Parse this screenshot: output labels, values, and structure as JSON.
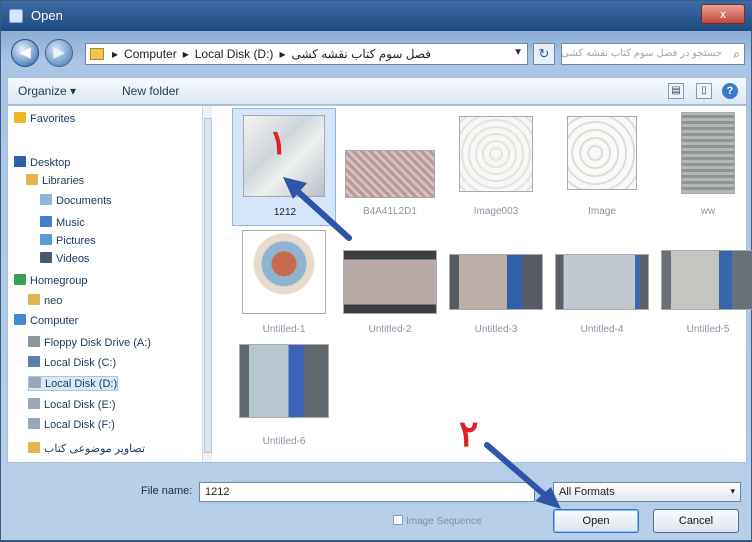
{
  "window": {
    "title": "Open",
    "close_label": "x"
  },
  "navigation": {
    "back_glyph": "◀",
    "forward_glyph": "▶",
    "breadcrumbs": [
      "Computer",
      "Local Disk (D:)",
      "فصل سوم کتاب نقشه کشی"
    ],
    "breadcrumb_separator": "▸",
    "refresh_glyph": "↻",
    "search_placeholder": "جستجو در فصل سوم کتاب نقشه کشی"
  },
  "toolbar": {
    "organize_label": "Organize ▾",
    "new_folder_label": "New folder",
    "help_glyph": "?"
  },
  "sidebar": {
    "items": [
      {
        "label": "Favorites",
        "icon": "star-icon",
        "color": "#f0b429"
      },
      {
        "label": "Desktop",
        "icon": "desktop-icon",
        "color": "#2e5fa8"
      },
      {
        "label": "Libraries",
        "icon": "libraries-icon",
        "color": "#e3b54f"
      },
      {
        "label": "Documents",
        "icon": "documents-icon",
        "color": "#8fb6e0"
      },
      {
        "label": "Music",
        "icon": "music-icon",
        "color": "#3f7fcf"
      },
      {
        "label": "Pictures",
        "icon": "pictures-icon",
        "color": "#5a9bd6"
      },
      {
        "label": "Videos",
        "icon": "videos-icon",
        "color": "#4b5a6a"
      },
      {
        "label": "Homegroup",
        "icon": "homegroup-icon",
        "color": "#3aa150"
      },
      {
        "label": "neo",
        "icon": "user-folder-icon",
        "color": "#e3b54f"
      },
      {
        "label": "Computer",
        "icon": "computer-icon",
        "color": "#4d86c8"
      },
      {
        "label": "Floppy Disk Drive (A:)",
        "icon": "floppy-icon",
        "color": "#8b96a3"
      },
      {
        "label": "Local Disk (C:)",
        "icon": "windows-drive-icon",
        "color": "#5a7fae"
      },
      {
        "label": "Local Disk (D:)",
        "icon": "drive-icon",
        "color": "#9aa7b6"
      },
      {
        "label": "Local Disk (E:)",
        "icon": "drive-icon",
        "color": "#9aa7b6"
      },
      {
        "label": "Local Disk (F:)",
        "icon": "drive-icon",
        "color": "#9aa7b6"
      },
      {
        "label": "تصاویر موضوعی کتاب",
        "icon": "folder-icon",
        "color": "#e3b54f"
      }
    ],
    "selected_index": 12
  },
  "files": [
    {
      "name": "1212",
      "selected": true
    },
    {
      "name": "B4A41L2D1",
      "selected": false
    },
    {
      "name": "Image003",
      "selected": false
    },
    {
      "name": "Image",
      "selected": false
    },
    {
      "name": "ww",
      "selected": false
    },
    {
      "name": "Untitled-1",
      "selected": false
    },
    {
      "name": "Untitled-2",
      "selected": false
    },
    {
      "name": "Untitled-3",
      "selected": false
    },
    {
      "name": "Untitled-4",
      "selected": false
    },
    {
      "name": "Untitled-5",
      "selected": false
    },
    {
      "name": "Untitled-6",
      "selected": false
    }
  ],
  "footer": {
    "file_name_label": "File name:",
    "file_name_value": "1212",
    "format_value": "All Formats",
    "format_dropdown_glyph": "▾",
    "image_sequence_label": "Image Sequence",
    "open_label": "Open",
    "cancel_label": "Cancel"
  },
  "annotations": {
    "step1": "۱",
    "step2": "۲",
    "arrow_color": "#2f55a8",
    "numeral_color": "#e21f26"
  }
}
